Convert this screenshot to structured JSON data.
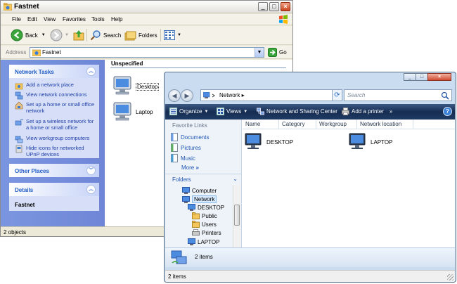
{
  "xp_window": {
    "title": "Fastnet",
    "menu": [
      "File",
      "Edit",
      "View",
      "Favorites",
      "Tools",
      "Help"
    ],
    "toolbar": {
      "back": "Back",
      "search": "Search",
      "folders": "Folders"
    },
    "address": {
      "label": "Address",
      "value": "Fastnet",
      "go": "Go"
    },
    "network_tasks": {
      "title": "Network Tasks",
      "items": [
        "Add a network place",
        "View network connections",
        "Set up a home or small office network",
        "Set up a wireless network for a home or small office",
        "View workgroup computers",
        "Hide icons for networked UPnP devices"
      ]
    },
    "other_places": {
      "title": "Other Places"
    },
    "details": {
      "title": "Details",
      "name": "Fastnet"
    },
    "group_header": "Unspecified",
    "items": [
      "Desktop",
      "Laptop"
    ],
    "status": "2 objects"
  },
  "vista_window": {
    "address": "Network",
    "search_placeholder": "Search",
    "commands": [
      "Organize",
      "Views",
      "Network and Sharing Center",
      "Add a printer"
    ],
    "favorite_links": {
      "title": "Favorite Links",
      "items": [
        "Documents",
        "Pictures",
        "Music"
      ],
      "more": "More"
    },
    "folders_title": "Folders",
    "tree": [
      "Computer",
      "Network",
      "DESKTOP",
      "Public",
      "Users",
      "Printers",
      "LAPTOP"
    ],
    "columns": [
      "Name",
      "Category",
      "Workgroup",
      "Network location"
    ],
    "items": [
      "DESKTOP",
      "LAPTOP"
    ],
    "details_text": "2 items",
    "status": "2 items"
  },
  "colors": {
    "xp_task_pane": "#7b96e0",
    "xp_link": "#1f3fa8",
    "vista_command_bar": "#1e3a63",
    "vista_link": "#1e55b3"
  }
}
